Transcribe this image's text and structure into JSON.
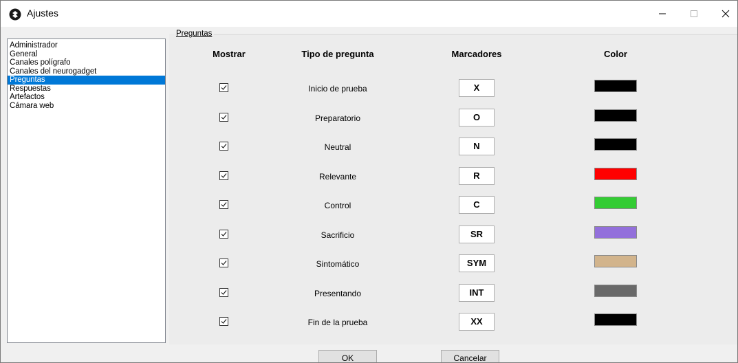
{
  "window": {
    "title": "Ajustes"
  },
  "sidebar": {
    "items": [
      {
        "label": "Administrador"
      },
      {
        "label": "General"
      },
      {
        "label": "Canales polígrafo"
      },
      {
        "label": "Canales del neurogadget"
      },
      {
        "label": "Preguntas",
        "selected": true
      },
      {
        "label": "Respuestas"
      },
      {
        "label": "Artefactos"
      },
      {
        "label": "Cámara web"
      }
    ]
  },
  "group": {
    "label": "Preguntas"
  },
  "columns": {
    "show": "Mostrar",
    "type": "Tipo de pregunta",
    "markers": "Marcadores",
    "color": "Color"
  },
  "rows": [
    {
      "checked": true,
      "type": "Inicio de prueba",
      "marker": "X",
      "color": "#000000"
    },
    {
      "checked": true,
      "type": "Preparatorio",
      "marker": "O",
      "color": "#000000"
    },
    {
      "checked": true,
      "type": "Neutral",
      "marker": "N",
      "color": "#000000"
    },
    {
      "checked": true,
      "type": "Relevante",
      "marker": "R",
      "color": "#ff0000"
    },
    {
      "checked": true,
      "type": "Control",
      "marker": "C",
      "color": "#33cc33"
    },
    {
      "checked": true,
      "type": "Sacrificio",
      "marker": "SR",
      "color": "#9370db"
    },
    {
      "checked": true,
      "type": "Sintomático",
      "marker": "SYM",
      "color": "#d2b48c"
    },
    {
      "checked": true,
      "type": "Presentando",
      "marker": "INT",
      "color": "#696969"
    },
    {
      "checked": true,
      "type": "Fin de la prueba",
      "marker": "XX",
      "color": "#000000"
    }
  ],
  "buttons": {
    "ok": "OK",
    "cancel": "Cancelar"
  }
}
